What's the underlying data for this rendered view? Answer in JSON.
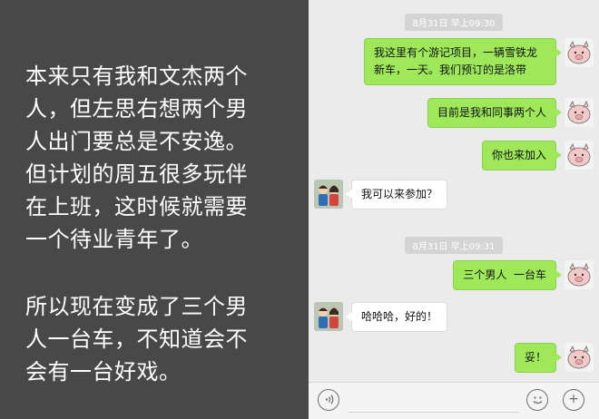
{
  "caption": {
    "paragraph1": "本来只有我和文杰两个\n人，但左思右想两个男\n人出门要总是不安逸。\n但计划的周五很多玩伴\n在上班，这时候就需要\n一个待业青年了。",
    "paragraph2": "所以现在变成了三个男\n人一台车，不知道会不\n会有一台好戏。"
  },
  "chat": {
    "timestamp1": "8月31日 早上09:30",
    "timestamp2": "8月31日 早上09:31",
    "messages": [
      {
        "side": "right",
        "text": "我这里有个游记项目，一辆雪铁龙\n新车，一天。我们预订的是洛带"
      },
      {
        "side": "right",
        "text": "目前是我和同事两个人"
      },
      {
        "side": "right",
        "text": "你也来加入"
      },
      {
        "side": "left",
        "text": "我可以来参加？"
      },
      {
        "side": "right",
        "text": "三个男人  一台车"
      },
      {
        "side": "left",
        "text": "哈哈哈，好的！"
      },
      {
        "side": "right",
        "text": "妥！"
      }
    ],
    "avatar_me": "pig-avatar",
    "avatar_friend": "couple-figurine-avatar"
  },
  "input_bar": {
    "voice_icon": "voice-icon",
    "emoji_icon": "emoji-icon",
    "plus_icon": "plus-icon",
    "plus_glyph": "+"
  },
  "colors": {
    "left_panel": "#484848",
    "chat_bg": "#ebebeb",
    "bubble_green": "#9fe85a",
    "bubble_white": "#ffffff"
  }
}
